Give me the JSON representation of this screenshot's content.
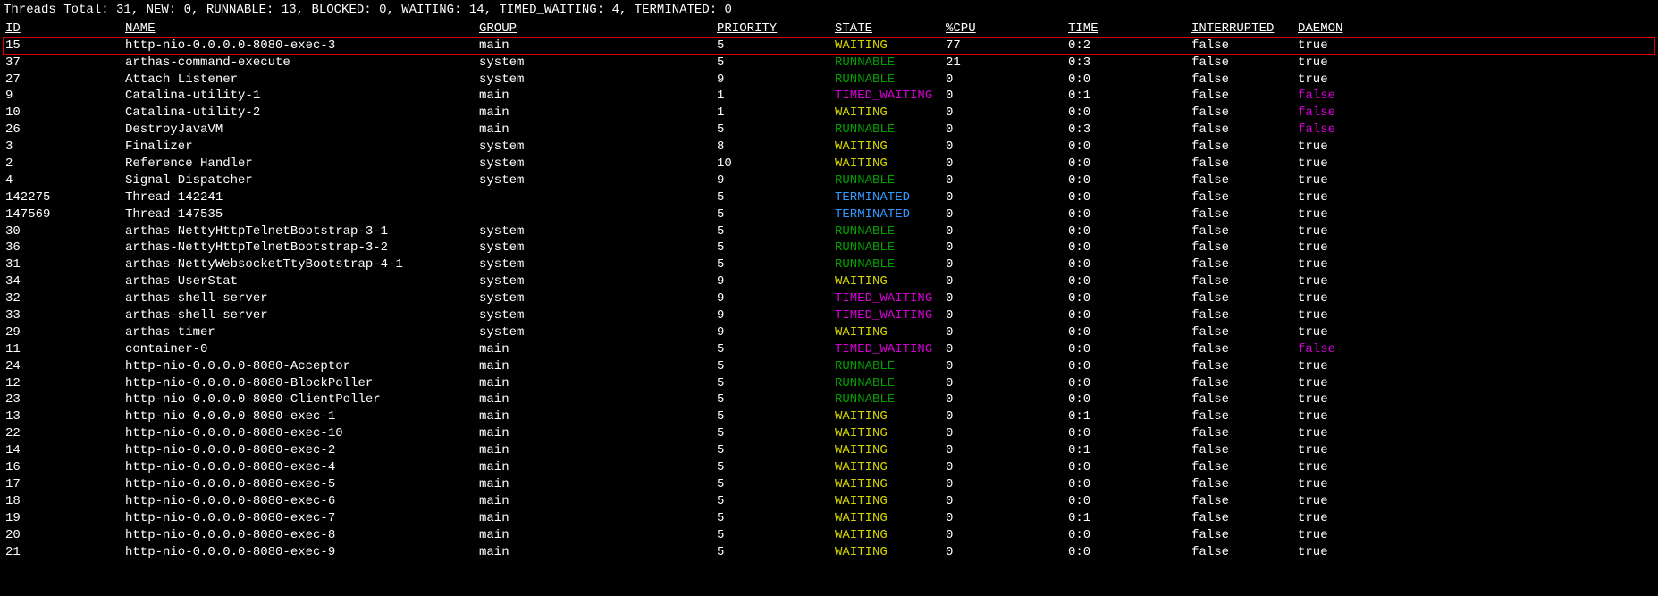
{
  "summary": "Threads Total: 31, NEW: 0, RUNNABLE: 13, BLOCKED: 0, WAITING: 14, TIMED_WAITING: 4, TERMINATED: 0",
  "columns": {
    "id": "ID",
    "name": "NAME",
    "group": "GROUP",
    "priority": "PRIORITY",
    "state": "STATE",
    "cpu": "%CPU",
    "time": "TIME",
    "interrupted": "INTERRUPTED",
    "daemon": "DAEMON"
  },
  "highlight_id": "15",
  "threads": [
    {
      "id": "15",
      "name": "http-nio-0.0.0.0-8080-exec-3",
      "group": "main",
      "priority": "5",
      "state": "WAITING",
      "cpu": "77",
      "time": "0:2",
      "interrupted": "false",
      "daemon": "true"
    },
    {
      "id": "37",
      "name": "arthas-command-execute",
      "group": "system",
      "priority": "5",
      "state": "RUNNABLE",
      "cpu": "21",
      "time": "0:3",
      "interrupted": "false",
      "daemon": "true"
    },
    {
      "id": "27",
      "name": "Attach Listener",
      "group": "system",
      "priority": "9",
      "state": "RUNNABLE",
      "cpu": "0",
      "time": "0:0",
      "interrupted": "false",
      "daemon": "true"
    },
    {
      "id": "9",
      "name": "Catalina-utility-1",
      "group": "main",
      "priority": "1",
      "state": "TIMED_WAITING",
      "cpu": "0",
      "time": "0:1",
      "interrupted": "false",
      "daemon": "false"
    },
    {
      "id": "10",
      "name": "Catalina-utility-2",
      "group": "main",
      "priority": "1",
      "state": "WAITING",
      "cpu": "0",
      "time": "0:0",
      "interrupted": "false",
      "daemon": "false"
    },
    {
      "id": "26",
      "name": "DestroyJavaVM",
      "group": "main",
      "priority": "5",
      "state": "RUNNABLE",
      "cpu": "0",
      "time": "0:3",
      "interrupted": "false",
      "daemon": "false"
    },
    {
      "id": "3",
      "name": "Finalizer",
      "group": "system",
      "priority": "8",
      "state": "WAITING",
      "cpu": "0",
      "time": "0:0",
      "interrupted": "false",
      "daemon": "true"
    },
    {
      "id": "2",
      "name": "Reference Handler",
      "group": "system",
      "priority": "10",
      "state": "WAITING",
      "cpu": "0",
      "time": "0:0",
      "interrupted": "false",
      "daemon": "true"
    },
    {
      "id": "4",
      "name": "Signal Dispatcher",
      "group": "system",
      "priority": "9",
      "state": "RUNNABLE",
      "cpu": "0",
      "time": "0:0",
      "interrupted": "false",
      "daemon": "true"
    },
    {
      "id": "142275",
      "name": "Thread-142241",
      "group": "",
      "priority": "5",
      "state": "TERMINATED",
      "cpu": "0",
      "time": "0:0",
      "interrupted": "false",
      "daemon": "true"
    },
    {
      "id": "147569",
      "name": "Thread-147535",
      "group": "",
      "priority": "5",
      "state": "TERMINATED",
      "cpu": "0",
      "time": "0:0",
      "interrupted": "false",
      "daemon": "true"
    },
    {
      "id": "30",
      "name": "arthas-NettyHttpTelnetBootstrap-3-1",
      "group": "system",
      "priority": "5",
      "state": "RUNNABLE",
      "cpu": "0",
      "time": "0:0",
      "interrupted": "false",
      "daemon": "true"
    },
    {
      "id": "36",
      "name": "arthas-NettyHttpTelnetBootstrap-3-2",
      "group": "system",
      "priority": "5",
      "state": "RUNNABLE",
      "cpu": "0",
      "time": "0:0",
      "interrupted": "false",
      "daemon": "true"
    },
    {
      "id": "31",
      "name": "arthas-NettyWebsocketTtyBootstrap-4-1",
      "group": "system",
      "priority": "5",
      "state": "RUNNABLE",
      "cpu": "0",
      "time": "0:0",
      "interrupted": "false",
      "daemon": "true"
    },
    {
      "id": "34",
      "name": "arthas-UserStat",
      "group": "system",
      "priority": "9",
      "state": "WAITING",
      "cpu": "0",
      "time": "0:0",
      "interrupted": "false",
      "daemon": "true"
    },
    {
      "id": "32",
      "name": "arthas-shell-server",
      "group": "system",
      "priority": "9",
      "state": "TIMED_WAITING",
      "cpu": "0",
      "time": "0:0",
      "interrupted": "false",
      "daemon": "true"
    },
    {
      "id": "33",
      "name": "arthas-shell-server",
      "group": "system",
      "priority": "9",
      "state": "TIMED_WAITING",
      "cpu": "0",
      "time": "0:0",
      "interrupted": "false",
      "daemon": "true"
    },
    {
      "id": "29",
      "name": "arthas-timer",
      "group": "system",
      "priority": "9",
      "state": "WAITING",
      "cpu": "0",
      "time": "0:0",
      "interrupted": "false",
      "daemon": "true"
    },
    {
      "id": "11",
      "name": "container-0",
      "group": "main",
      "priority": "5",
      "state": "TIMED_WAITING",
      "cpu": "0",
      "time": "0:0",
      "interrupted": "false",
      "daemon": "false"
    },
    {
      "id": "24",
      "name": "http-nio-0.0.0.0-8080-Acceptor",
      "group": "main",
      "priority": "5",
      "state": "RUNNABLE",
      "cpu": "0",
      "time": "0:0",
      "interrupted": "false",
      "daemon": "true"
    },
    {
      "id": "12",
      "name": "http-nio-0.0.0.0-8080-BlockPoller",
      "group": "main",
      "priority": "5",
      "state": "RUNNABLE",
      "cpu": "0",
      "time": "0:0",
      "interrupted": "false",
      "daemon": "true"
    },
    {
      "id": "23",
      "name": "http-nio-0.0.0.0-8080-ClientPoller",
      "group": "main",
      "priority": "5",
      "state": "RUNNABLE",
      "cpu": "0",
      "time": "0:0",
      "interrupted": "false",
      "daemon": "true"
    },
    {
      "id": "13",
      "name": "http-nio-0.0.0.0-8080-exec-1",
      "group": "main",
      "priority": "5",
      "state": "WAITING",
      "cpu": "0",
      "time": "0:1",
      "interrupted": "false",
      "daemon": "true"
    },
    {
      "id": "22",
      "name": "http-nio-0.0.0.0-8080-exec-10",
      "group": "main",
      "priority": "5",
      "state": "WAITING",
      "cpu": "0",
      "time": "0:0",
      "interrupted": "false",
      "daemon": "true"
    },
    {
      "id": "14",
      "name": "http-nio-0.0.0.0-8080-exec-2",
      "group": "main",
      "priority": "5",
      "state": "WAITING",
      "cpu": "0",
      "time": "0:1",
      "interrupted": "false",
      "daemon": "true"
    },
    {
      "id": "16",
      "name": "http-nio-0.0.0.0-8080-exec-4",
      "group": "main",
      "priority": "5",
      "state": "WAITING",
      "cpu": "0",
      "time": "0:0",
      "interrupted": "false",
      "daemon": "true"
    },
    {
      "id": "17",
      "name": "http-nio-0.0.0.0-8080-exec-5",
      "group": "main",
      "priority": "5",
      "state": "WAITING",
      "cpu": "0",
      "time": "0:0",
      "interrupted": "false",
      "daemon": "true"
    },
    {
      "id": "18",
      "name": "http-nio-0.0.0.0-8080-exec-6",
      "group": "main",
      "priority": "5",
      "state": "WAITING",
      "cpu": "0",
      "time": "0:0",
      "interrupted": "false",
      "daemon": "true"
    },
    {
      "id": "19",
      "name": "http-nio-0.0.0.0-8080-exec-7",
      "group": "main",
      "priority": "5",
      "state": "WAITING",
      "cpu": "0",
      "time": "0:1",
      "interrupted": "false",
      "daemon": "true"
    },
    {
      "id": "20",
      "name": "http-nio-0.0.0.0-8080-exec-8",
      "group": "main",
      "priority": "5",
      "state": "WAITING",
      "cpu": "0",
      "time": "0:0",
      "interrupted": "false",
      "daemon": "true"
    },
    {
      "id": "21",
      "name": "http-nio-0.0.0.0-8080-exec-9",
      "group": "main",
      "priority": "5",
      "state": "WAITING",
      "cpu": "0",
      "time": "0:0",
      "interrupted": "false",
      "daemon": "true"
    }
  ]
}
